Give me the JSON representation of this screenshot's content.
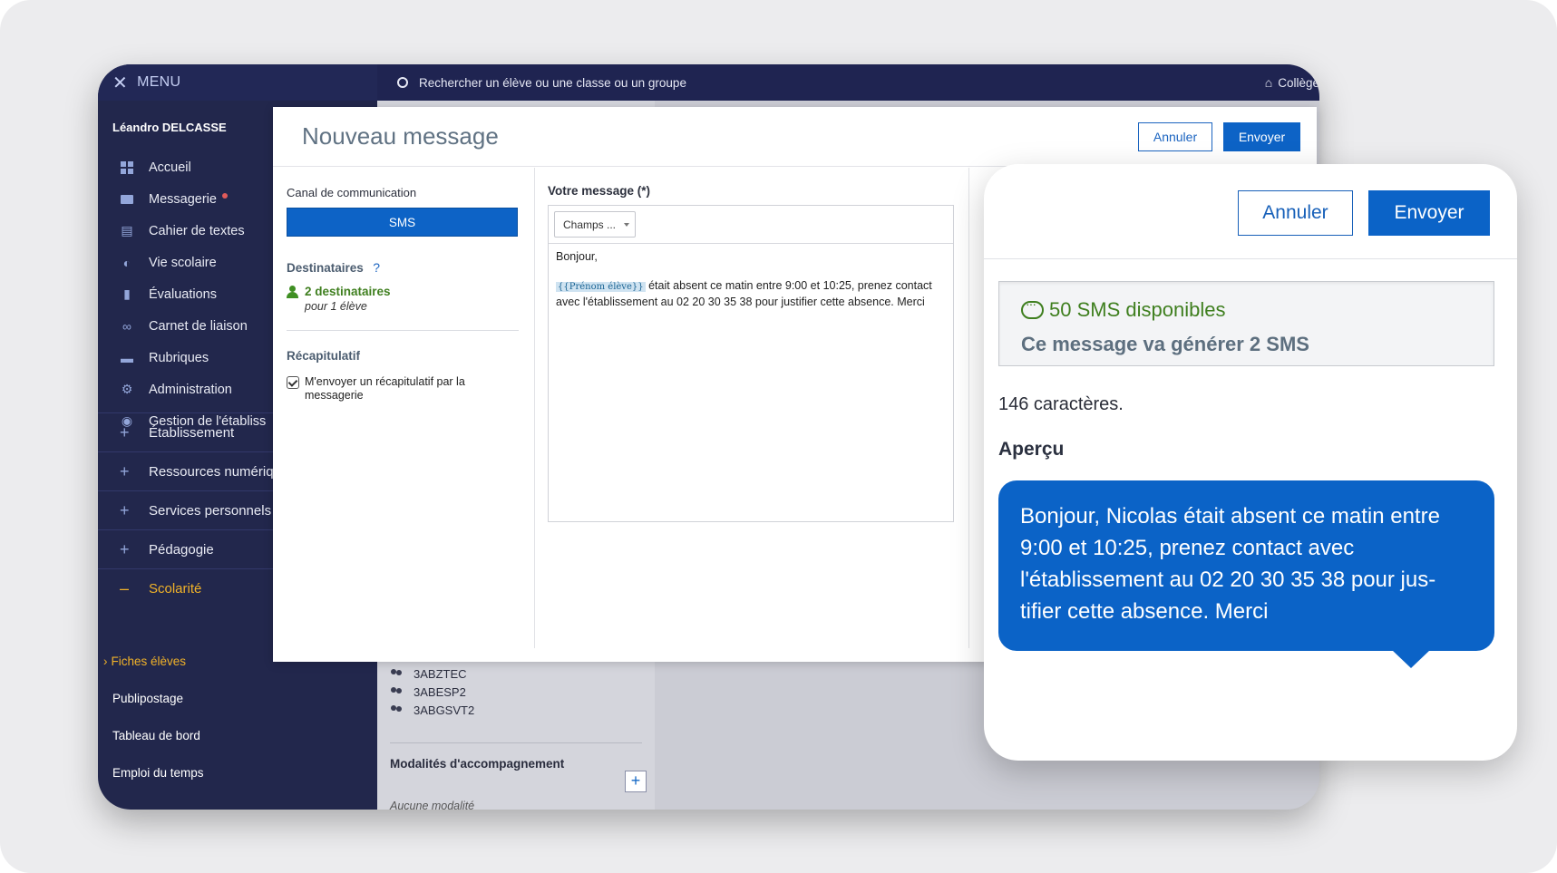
{
  "menu": {
    "close_icon": "close-icon",
    "label": "MENU"
  },
  "user": {
    "name": "Léandro DELCASSE"
  },
  "nav": [
    {
      "label": "Accueil",
      "icon": "grid-icon"
    },
    {
      "label": "Messagerie",
      "icon": "envelope-icon",
      "badge": "unread-dot"
    },
    {
      "label": "Cahier de textes",
      "icon": "notebook-icon"
    },
    {
      "label": "Vie scolaire",
      "icon": "moon-icon"
    },
    {
      "label": "Évaluations",
      "icon": "bar-chart-icon"
    },
    {
      "label": "Carnet de liaison",
      "icon": "link-icon"
    },
    {
      "label": "Rubriques",
      "icon": "comment-icon"
    },
    {
      "label": "Administration",
      "icon": "gear-icon"
    },
    {
      "label": "Gestion de l'établiss",
      "icon": "location-icon"
    }
  ],
  "sections": [
    {
      "label": "Établissement",
      "toggle": "+"
    },
    {
      "label": "Ressources numériq",
      "toggle": "+"
    },
    {
      "label": "Services personnels",
      "toggle": "+"
    },
    {
      "label": "Pédagogie",
      "toggle": "+"
    },
    {
      "label": "Scolarité",
      "toggle": "–"
    }
  ],
  "subnav": [
    {
      "label": "Fiches élèves",
      "prefix": "›"
    },
    {
      "label": "Publipostage"
    },
    {
      "label": "Tableau de bord"
    },
    {
      "label": "Emploi du temps"
    }
  ],
  "topbar": {
    "search_placeholder": "Rechercher un élève ou une classe ou un groupe",
    "school": "Collège"
  },
  "background_panel": {
    "groups": [
      "3ABZTEC",
      "3ABESP2",
      "3ABGSVT2"
    ],
    "modalites_title": "Modalités d'accompagnement",
    "modalites_value": "Aucune modalité",
    "add_symbol": "+"
  },
  "dialog": {
    "title": "Nouveau message",
    "cancel": "Annuler",
    "send": "Envoyer",
    "canal_label": "Canal de communication",
    "canal_value": "SMS",
    "destinataires_label": "Destinataires",
    "help": "?",
    "dest_count": "2 destinataires",
    "dest_sub": "pour 1 élève",
    "recap_label": "Récapitulatif",
    "recap_checkbox": "M'envoyer un récapitulatif par la messagerie",
    "message_label": "Votre message (*)",
    "champs": "Champs ...",
    "message_line1": "Bonjour,",
    "tag": "{{Prénom élève}}",
    "message_rest": " était absent ce matin entre 9:00 et 10:25, prenez contact avec l'établissement au 02 20 30 35 38 pour justifier cette absence. Merci"
  },
  "card": {
    "cancel": "Annuler",
    "send": "Envoyer",
    "sms_available": "50 SMS disponibles",
    "sms_generate": "Ce message va générer 2 SMS",
    "chars": "146 caractères.",
    "preview_label": "Aperçu",
    "preview_text": "Bonjour, Nicolas était absent ce matin entre 9:00 et 10:25, prenez contact avec l'établissement au 02 20 30 35 38 pour jus-tifier cette absence. Merci"
  },
  "colors": {
    "sidebar": "#22274c",
    "accent_blue": "#0d63c6",
    "active_orange": "#f0b229",
    "success_green": "#3f7f1f"
  }
}
